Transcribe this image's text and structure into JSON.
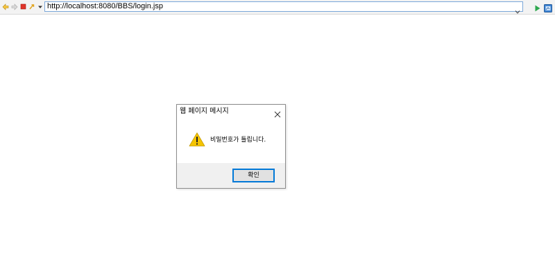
{
  "browser": {
    "address_url": "http://localhost:8080/BBS/login.jsp",
    "toolbar_icons": [
      "back-arrow-icon",
      "forward-arrow-icon",
      "stop-icon",
      "refresh-icon",
      "menu-dropdown-icon"
    ],
    "address_dropdown_icon": "chevron-down-icon",
    "go_icon": "play-arrow-icon",
    "extra_icon": "external-browser-icon"
  },
  "dialog": {
    "title": "웹 페이지 메시지",
    "message": "비밀번호가 틀립니다.",
    "ok_label": "확인",
    "icon": "warning-icon",
    "close_icon": "close-icon"
  },
  "colors": {
    "warning": "#f5c400",
    "focus": "#0078d7"
  }
}
